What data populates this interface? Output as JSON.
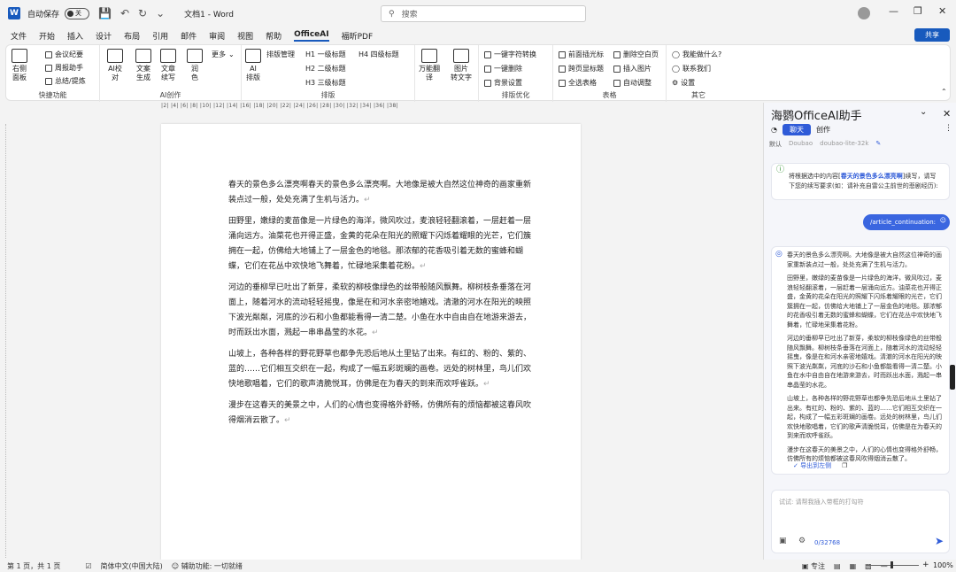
{
  "titlebar": {
    "autosave": "自动保存",
    "toggle": "关",
    "doc_title": "文档1 - Word",
    "search_placeholder": "搜索"
  },
  "menu": [
    "文件",
    "开始",
    "插入",
    "设计",
    "布局",
    "引用",
    "邮件",
    "审阅",
    "视图",
    "帮助",
    "OfficeAI",
    "福昕PDF"
  ],
  "share": "共享",
  "ribbon": {
    "quick": {
      "label": "快捷功能",
      "right_panel": "右侧\n面板",
      "items": [
        "会议纪要",
        "周报助手",
        "总结/提炼"
      ]
    },
    "ai": {
      "label": "AI创作",
      "ai_check": "AI校\n对",
      "gen": "文案\n生成",
      "continue": "文章\n续写",
      "polish": "润\n色",
      "more": "更多"
    },
    "layout": {
      "label": "排版",
      "ai_layout": "AI\n排版",
      "manage": "排版管理",
      "h1": "H1 一级标题",
      "h2": "H2 二级标题",
      "h3": "H3 三级标题",
      "h4": "H4 四级标题"
    },
    "translate": "万能翻\n译",
    "img2text": "图片\n转文字",
    "opt": {
      "label": "排版优化",
      "a": "一键字符转换",
      "b": "一键删除",
      "c": "背景设置"
    },
    "table": {
      "label": "表格",
      "a": "前面插光标",
      "b": "跨页显标题",
      "c": "全选表格",
      "d": "删除空白页",
      "e": "插入图片",
      "f": "自动调整"
    },
    "other": {
      "label": "其它",
      "a": "我能做什么?",
      "b": "联系我们",
      "c": "设置"
    }
  },
  "ruler": "|2|  |4|  |6|  |8|  |10|  |12|  |14|  |16|  |18|  |20|  |22|  |24|  |26|  |28|  |30|  |32|  |34|  |36|  |38|",
  "document": [
    "春天的景色多么漂亮啊春天的景色多么漂亮啊。大地像是被大自然这位神奇的画家重新装点过一般，处处充满了生机与活力。",
    "田野里，嫩绿的麦苗像是一片绿色的海洋，微风吹过，麦浪轻轻翻滚着，一层赶着一层涌向远方。油菜花也开得正盛，金黄的花朵在阳光的照耀下闪烁着耀眼的光芒，它们簇拥在一起，仿佛给大地铺上了一层金色的地毯。那浓郁的花香吸引着无数的蜜蜂和蝴蝶，它们在花丛中欢快地飞舞着，忙碌地采集着花粉。",
    "河边的垂柳早已吐出了新芽，柔软的柳枝像绿色的丝带般随风飘舞。柳树枝条垂落在河面上，随着河水的流动轻轻摇曳，像是在和河水亲密地嬉戏。清澈的河水在阳光的映照下波光粼粼，河底的沙石和小鱼都能看得一清二楚。小鱼在水中自由自在地游来游去，时而跃出水面，溅起一串串晶莹的水花。",
    "山坡上，各种各样的野花野草也都争先恐后地从土里钻了出来。有红的、粉的、紫的、蓝的……它们相互交织在一起，构成了一幅五彩斑斓的画卷。远处的树林里，鸟儿们欢快地歌唱着，它们的歌声清脆悦耳，仿佛是在为春天的到来而欢呼雀跃。",
    "漫步在这春天的美景之中，人们的心情也变得格外舒畅，仿佛所有的烦恼都被这春风吹得烟消云散了。"
  ],
  "panel": {
    "title": "海鹦OfficeAI助手",
    "tab_chat": "聊天",
    "tab_create": "创作",
    "default": "默认",
    "model1": "Doubao",
    "model2": "doubao-lite-32k",
    "prompt_pre": "将根据选中的内容",
    "prompt_hl": "春天的景色多么漂亮啊",
    "prompt_post": "续写，请写下您的续写要求(如：请补充自雷公主前世的悲剧经历):",
    "user_cmd": "/article_continuation:",
    "reply": [
      "春天的景色多么漂亮啊。大地像是被大自然这位神奇的画家重新装点过一般，处处充满了生机与活力。",
      "田野里，嫩绿的麦苗像是一片绿色的海洋，微风吹过，麦浪轻轻翻滚着，一层赶着一层涌向远方。油菜花也开得正盛，金黄的花朵在阳光的照耀下闪烁着耀眼的光芒，它们簇拥在一起，仿佛给大地铺上了一层金色的地毯。那浓郁的花香吸引着无数的蜜蜂和蝴蝶，它们在花丛中欢快地飞舞着，忙碌地采集着花粉。",
      "河边的垂柳早已吐出了新芽，柔软的柳枝像绿色的丝带般随风飘舞。柳树枝条垂落在河面上，随着河水的流动轻轻摇曳，像是在和河水亲密地嬉戏。清澈的河水在阳光的映照下波光粼粼，河底的沙石和小鱼都能看得一清二楚。小鱼在水中自由自在地游来游去，时而跃出水面，溅起一串串晶莹的水花。",
      "山坡上，各种各样的野花野草也都争先恐后地从土里钻了出来。有红的、粉的、紫的、蓝的……它们相互交织在一起，构成了一幅五彩斑斓的画卷。远处的树林里，鸟儿们欢快地歌唱着，它们的歌声清脆悦耳，仿佛是在为春天的到来而欢呼雀跃。",
      "漫步在这春天的美景之中，人们的心情也变得格外舒畅，仿佛所有的烦恼都被这春风吹得烟消云散了。"
    ],
    "export": "导出到左侧",
    "input_placeholder": "试试: 请帮我插入带框的打勾符",
    "counter": "0/32768"
  },
  "status": {
    "page": "第 1 页，共 1 页",
    "lang": "简体中文(中国大陆)",
    "a11y": "辅助功能: 一切就绪",
    "focus": "专注",
    "zoom": "100%"
  },
  "colors": {
    "accent": "#185abd",
    "panel_accent": "#2f5bd8"
  }
}
